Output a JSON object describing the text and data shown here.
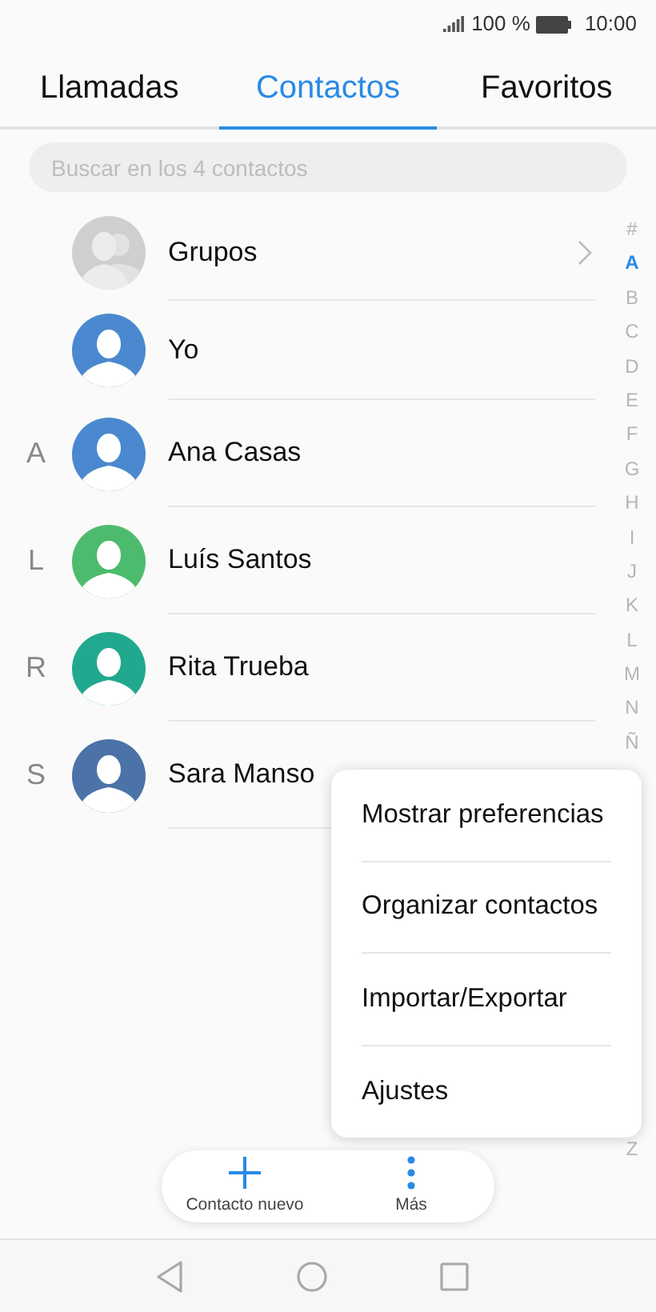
{
  "status_bar": {
    "battery": "100 %",
    "time": "10:00"
  },
  "tabs": [
    {
      "label": "Llamadas",
      "selected": false
    },
    {
      "label": "Contactos",
      "selected": true
    },
    {
      "label": "Favoritos",
      "selected": false
    }
  ],
  "search": {
    "placeholder": "Buscar en los 4 contactos"
  },
  "contacts": [
    {
      "kind": "group",
      "name": "Grupos",
      "color": "#cfcfcf"
    },
    {
      "kind": "contact",
      "name": "Yo",
      "color": "#4a89cf"
    },
    {
      "kind": "contact",
      "section": "A",
      "name": "Ana Casas",
      "color": "#4a89cf"
    },
    {
      "kind": "contact",
      "section": "L",
      "name": "Luís Santos",
      "color": "#4dbb6d"
    },
    {
      "kind": "contact",
      "section": "R",
      "name": "Rita Trueba",
      "color": "#21a98f"
    },
    {
      "kind": "contact",
      "section": "S",
      "name": "Sara Manso",
      "color": "#4b73a8"
    }
  ],
  "index": {
    "top": [
      {
        "label": "#",
        "selected": false
      },
      {
        "label": "A",
        "selected": true
      },
      {
        "label": "B",
        "selected": false
      },
      {
        "label": "C",
        "selected": false
      },
      {
        "label": "D",
        "selected": false
      },
      {
        "label": "E",
        "selected": false
      },
      {
        "label": "F",
        "selected": false
      },
      {
        "label": "G",
        "selected": false
      },
      {
        "label": "H",
        "selected": false
      },
      {
        "label": "I",
        "selected": false
      },
      {
        "label": "J",
        "selected": false
      },
      {
        "label": "K",
        "selected": false
      },
      {
        "label": "L",
        "selected": false
      },
      {
        "label": "M",
        "selected": false
      },
      {
        "label": "N",
        "selected": false
      },
      {
        "label": "Ñ",
        "selected": false
      }
    ],
    "bottom": [
      {
        "label": "Z",
        "selected": false
      }
    ]
  },
  "menu": [
    "Mostrar preferencias",
    "Organizar contactos",
    "Importar/Exportar",
    "Ajustes"
  ],
  "actions": [
    {
      "kind": "add",
      "label": "Contacto nuevo"
    },
    {
      "kind": "more",
      "label": "Más"
    }
  ]
}
